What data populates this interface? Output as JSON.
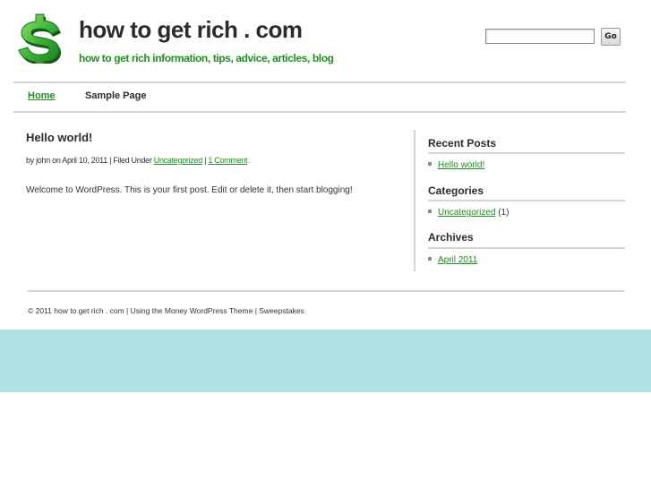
{
  "header": {
    "site_title": "how to get rich . com",
    "tagline": "how to get rich information, tips, advice, articles, blog",
    "logo_icon": "green-dollar-sign-icon",
    "search": {
      "value": "",
      "placeholder": "",
      "button_label": "Go"
    }
  },
  "nav": {
    "items": [
      {
        "label": "Home",
        "active": true
      },
      {
        "label": "Sample Page",
        "active": false
      }
    ]
  },
  "post": {
    "title": "Hello world!",
    "meta": {
      "prefix": "by john on April 10, 2011 | Filed Under ",
      "category": "Uncategorized",
      "separator": " | ",
      "comments": "1 Comment"
    },
    "body": "Welcome to WordPress. This is your first post. Edit or delete it, then start blogging!"
  },
  "sidebar": {
    "recent_posts": {
      "title": "Recent Posts",
      "items": [
        "Hello world!"
      ]
    },
    "categories": {
      "title": "Categories",
      "items": [
        {
          "label": "Uncategorized",
          "count": " (1)"
        }
      ]
    },
    "archives": {
      "title": "Archives",
      "items": [
        "April 2011"
      ]
    }
  },
  "footer": {
    "copyright": "© 2011 how to get rich . com | ",
    "theme_link": "Using the Money WordPress Theme",
    "separator": " | ",
    "sweepstakes_link": "Sweepstakes"
  },
  "colors": {
    "accent_green": "#1f8f1f",
    "heading": "#2b2b2b",
    "rule": "#d4d4d4",
    "bottom_band": "#b2e0e7"
  }
}
